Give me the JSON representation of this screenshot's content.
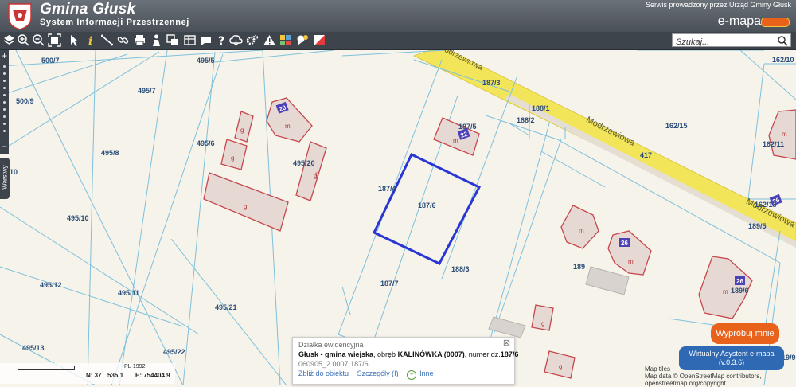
{
  "header": {
    "title": "Gmina Głusk",
    "subtitle": "System Informacji Przestrzennej",
    "service_text": "Serwis prowadzony przez Urząd Gminy Głusk",
    "brand": "e-mapa"
  },
  "toolbar": {
    "icons": [
      "layers-icon",
      "zoom-in-icon",
      "zoom-out-icon",
      "zoom-extent-icon",
      "pointer-icon",
      "info-icon",
      "measure-icon",
      "link-icon",
      "print-icon",
      "person-icon",
      "select-icon",
      "copy-icon",
      "comment-icon",
      "help-icon",
      "cloud-icon",
      "settings-icon",
      "warning-icon",
      "color-palette-icon",
      "chat-icon",
      "flag-icon"
    ],
    "search_placeholder": "Szukaj..."
  },
  "map": {
    "parcels": [
      "500/7",
      "495/5",
      "500/9",
      "495/7",
      "495/8",
      "495/6",
      "495/20",
      "495/10",
      "495/12",
      "495/11",
      "495/21",
      "495/13",
      "495/22",
      "187/4",
      "187/6",
      "187/7",
      "187/5",
      "187/3",
      "188/1",
      "188/2",
      "188/3",
      "162/15",
      "162/11",
      "162/10",
      "162/13",
      "189/5",
      "189",
      "189/6",
      "417",
      "10",
      "19/9"
    ],
    "streets": [
      "Modrzewiowa",
      "Modrzewiowa",
      "Modrzewiowa"
    ],
    "building_labels": [
      "m",
      "g",
      "g",
      "g",
      "g",
      "m",
      "g",
      "m",
      "m",
      "m",
      "m",
      "g",
      "g"
    ],
    "house_numbers": [
      "20",
      "22",
      "26",
      "26",
      "26"
    ]
  },
  "layers_tab": "Warstwy",
  "status": {
    "crs": "PL-1992",
    "x_label": "N: 37",
    "x_value": "535.1",
    "y_label": "E: 754404.9"
  },
  "popup": {
    "header": "Działka ewidencyjna",
    "line1_bold": "Głusk - gmina wiejska",
    "line1_rest": ", obręb ",
    "line1_obreb": "KALINÓWKA (0007)",
    "line1_numer": ", numer dz.",
    "line1_parcel": "187/6",
    "line2": "060905_2.0007.187/6",
    "link_zoom": "Zbliż do obiektu",
    "link_details": "Szczegóły (I)",
    "link_more": "Inne"
  },
  "try_button": "Wypróbuj mnie",
  "assistant": {
    "line1": "Wirtualny Asystent e-mapa",
    "line2": "(v.0.3.6)"
  },
  "attribution": {
    "line1": "Map tiles",
    "line2": "Map data © OpenStreetMap contributors, openstreetmap.org/copyright"
  },
  "colors": {
    "parcel_line": "#7ec0dc",
    "selected_parcel": "#2a35d6",
    "road": "#f3e55a",
    "building_outline": "#c5474d",
    "accent": "#e8621c",
    "assistant": "#2f69b4"
  }
}
